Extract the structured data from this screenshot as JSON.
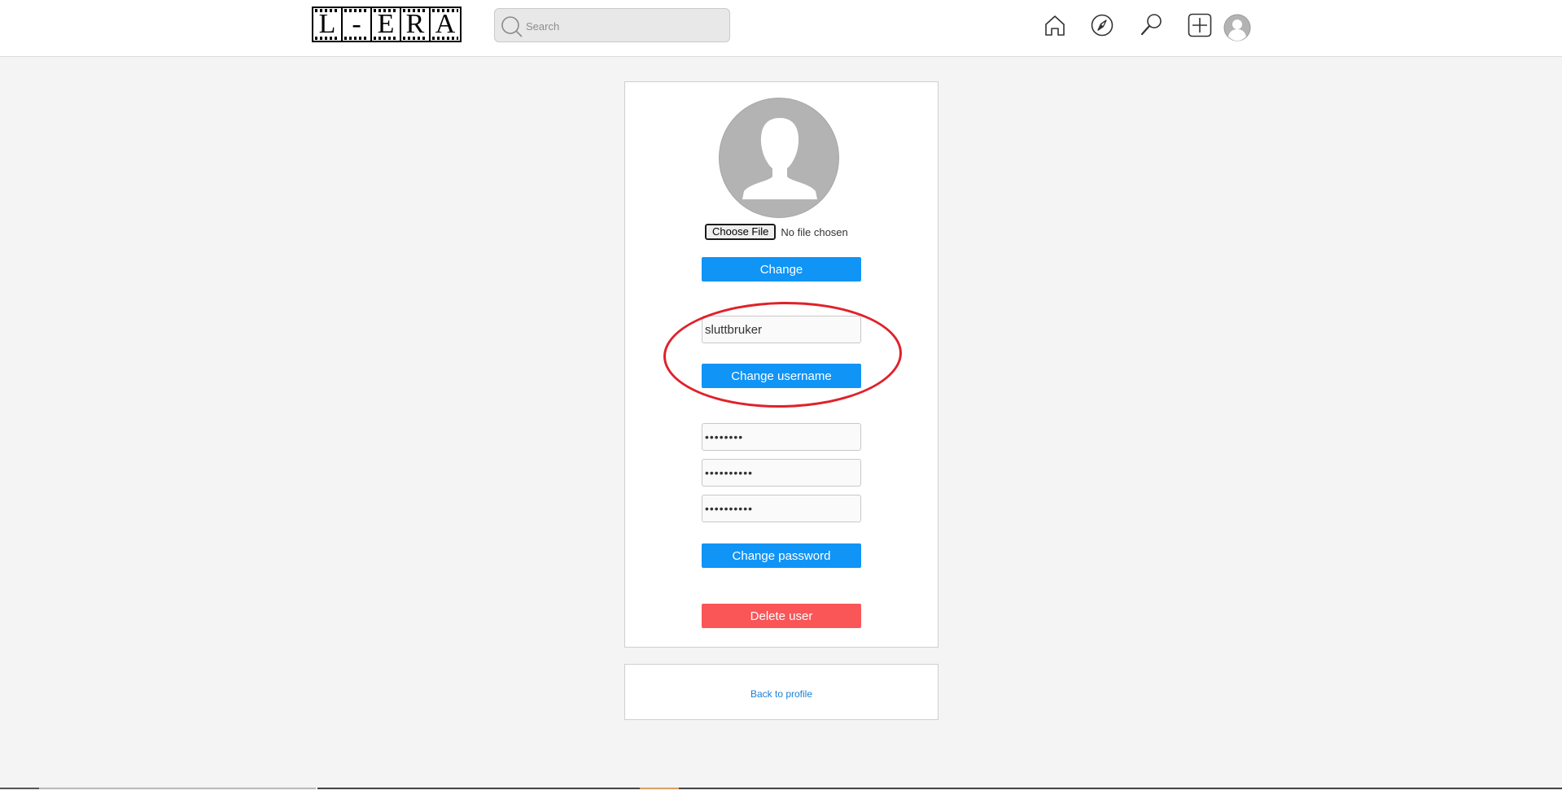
{
  "header": {
    "logo_letters": [
      "L",
      "-",
      "E",
      "R",
      "A"
    ],
    "search_placeholder": "Search",
    "nav_icons": [
      "home-icon",
      "compass-icon",
      "magnifier-icon",
      "add-post-icon",
      "profile-avatar-icon"
    ]
  },
  "profile_picture": {
    "choose_file_label": "Choose File",
    "file_status": "No file chosen",
    "change_button": "Change"
  },
  "username": {
    "value": "sluttbruker",
    "button": "Change username"
  },
  "password": {
    "fields": [
      "••••••••",
      "••••••••••",
      "••••••••••"
    ],
    "button": "Change password"
  },
  "delete": {
    "button": "Delete user"
  },
  "footer": {
    "back_link": "Back to profile"
  },
  "colors": {
    "primary_button": "#1094f6",
    "danger_button": "#fa5557",
    "annotation_ellipse": "#e0212b",
    "link": "#1a80d8"
  }
}
